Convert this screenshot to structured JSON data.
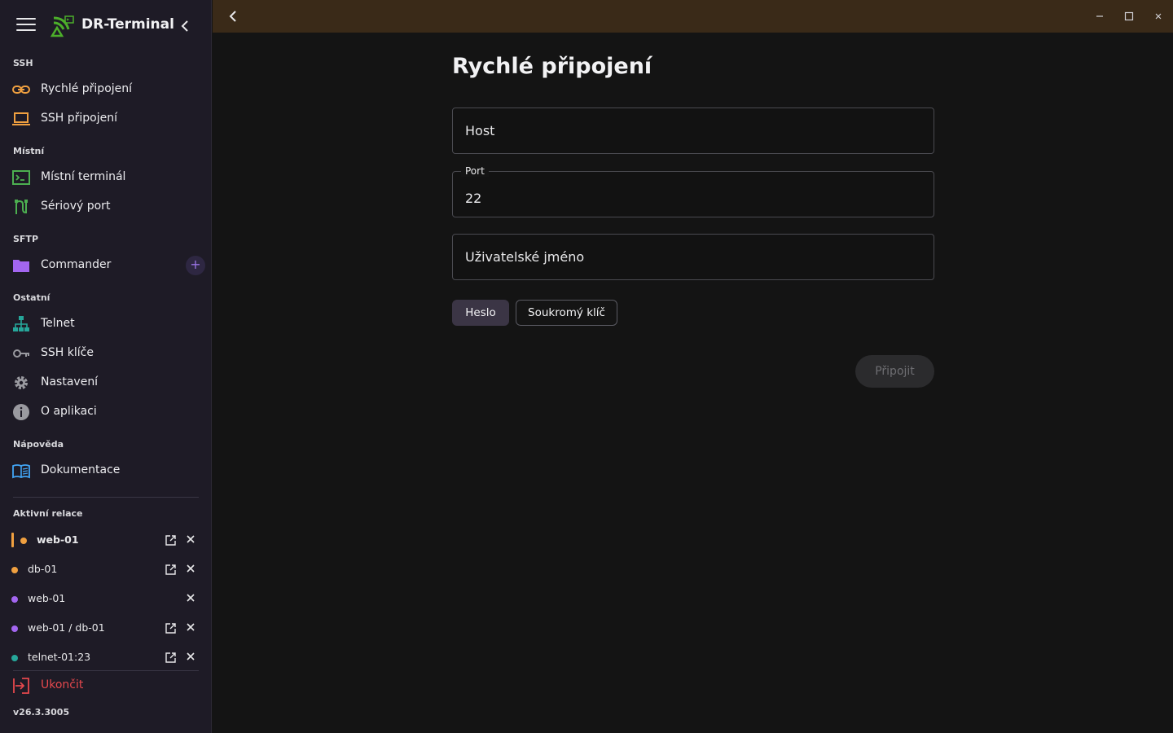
{
  "app": {
    "title": "DR-Terminal",
    "version": "v26.3.3005"
  },
  "sidebar": {
    "sections": {
      "ssh": "SSH",
      "local": "Místní",
      "sftp": "SFTP",
      "other": "Ostatní",
      "help": "Nápověda",
      "sessions": "Aktivní relace"
    },
    "items": [
      {
        "label": "Rychlé připojení",
        "icon": "link-icon"
      },
      {
        "label": "SSH připojení",
        "icon": "laptop-icon"
      },
      {
        "label": "Místní terminál",
        "icon": "terminal-icon"
      },
      {
        "label": "Sériový port",
        "icon": "serial-cable-icon"
      },
      {
        "label": "Commander",
        "icon": "folder-icon"
      },
      {
        "label": "Telnet",
        "icon": "network-tree-icon"
      },
      {
        "label": "SSH klíče",
        "icon": "key-icon"
      },
      {
        "label": "Nastavení",
        "icon": "gear-icon"
      },
      {
        "label": "O aplikaci",
        "icon": "info-icon"
      },
      {
        "label": "Dokumentace",
        "icon": "book-icon"
      }
    ],
    "sessions": [
      {
        "name": "web-01",
        "color": "#f0a040",
        "active": true
      },
      {
        "name": "db-01",
        "color": "#f0a040"
      },
      {
        "name": "web-01",
        "color": "#a366f0"
      },
      {
        "name": "web-01 / db-01",
        "color": "#a366f0"
      },
      {
        "name": "telnet-01:23",
        "color": "#26a69a"
      }
    ],
    "quit_label": "Ukončit"
  },
  "form": {
    "title": "Rychlé připojení",
    "host_placeholder": "Host",
    "port_label": "Port",
    "port_value": "22",
    "username_placeholder": "Uživatelské jméno",
    "auth_password": "Heslo",
    "auth_key": "Soukromý klíč",
    "connect_label": "Připojit"
  },
  "colors": {
    "titlebar": "#3a2a18",
    "sidebar_bg": "#1e1b26",
    "accent_purple": "#9a74e6",
    "quit_red": "#e5484d",
    "logo_green": "#4caf2a"
  }
}
